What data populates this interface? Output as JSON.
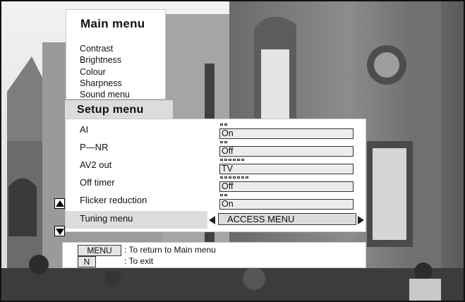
{
  "main_menu": {
    "title": "Main menu",
    "items": [
      "Contrast",
      "Brightness",
      "Colour",
      "Sharpness",
      "Sound menu"
    ]
  },
  "setup_menu": {
    "title": "Setup menu",
    "rows": [
      {
        "label": "AI",
        "value": "On",
        "level_markers": 2
      },
      {
        "label": "P—NR",
        "value": "Off",
        "level_markers": 2
      },
      {
        "label": "AV2 out",
        "value": "TV",
        "level_markers": 6
      },
      {
        "label": "Off timer",
        "value": "Off",
        "level_markers": 7
      },
      {
        "label": "Flicker reduction",
        "value": "On",
        "level_markers": 2
      }
    ],
    "selected_row": {
      "label": "Tuning menu",
      "value": "ACCESS MENU"
    }
  },
  "help": {
    "menu_key": "MENU",
    "menu_text": ": To return to Main menu",
    "n_key": "N",
    "n_text": ": To exit"
  },
  "icons": {
    "scroll_up": "triangle-up-icon",
    "scroll_down": "triangle-down-icon",
    "prev": "triangle-left-icon",
    "next": "triangle-right-icon"
  }
}
